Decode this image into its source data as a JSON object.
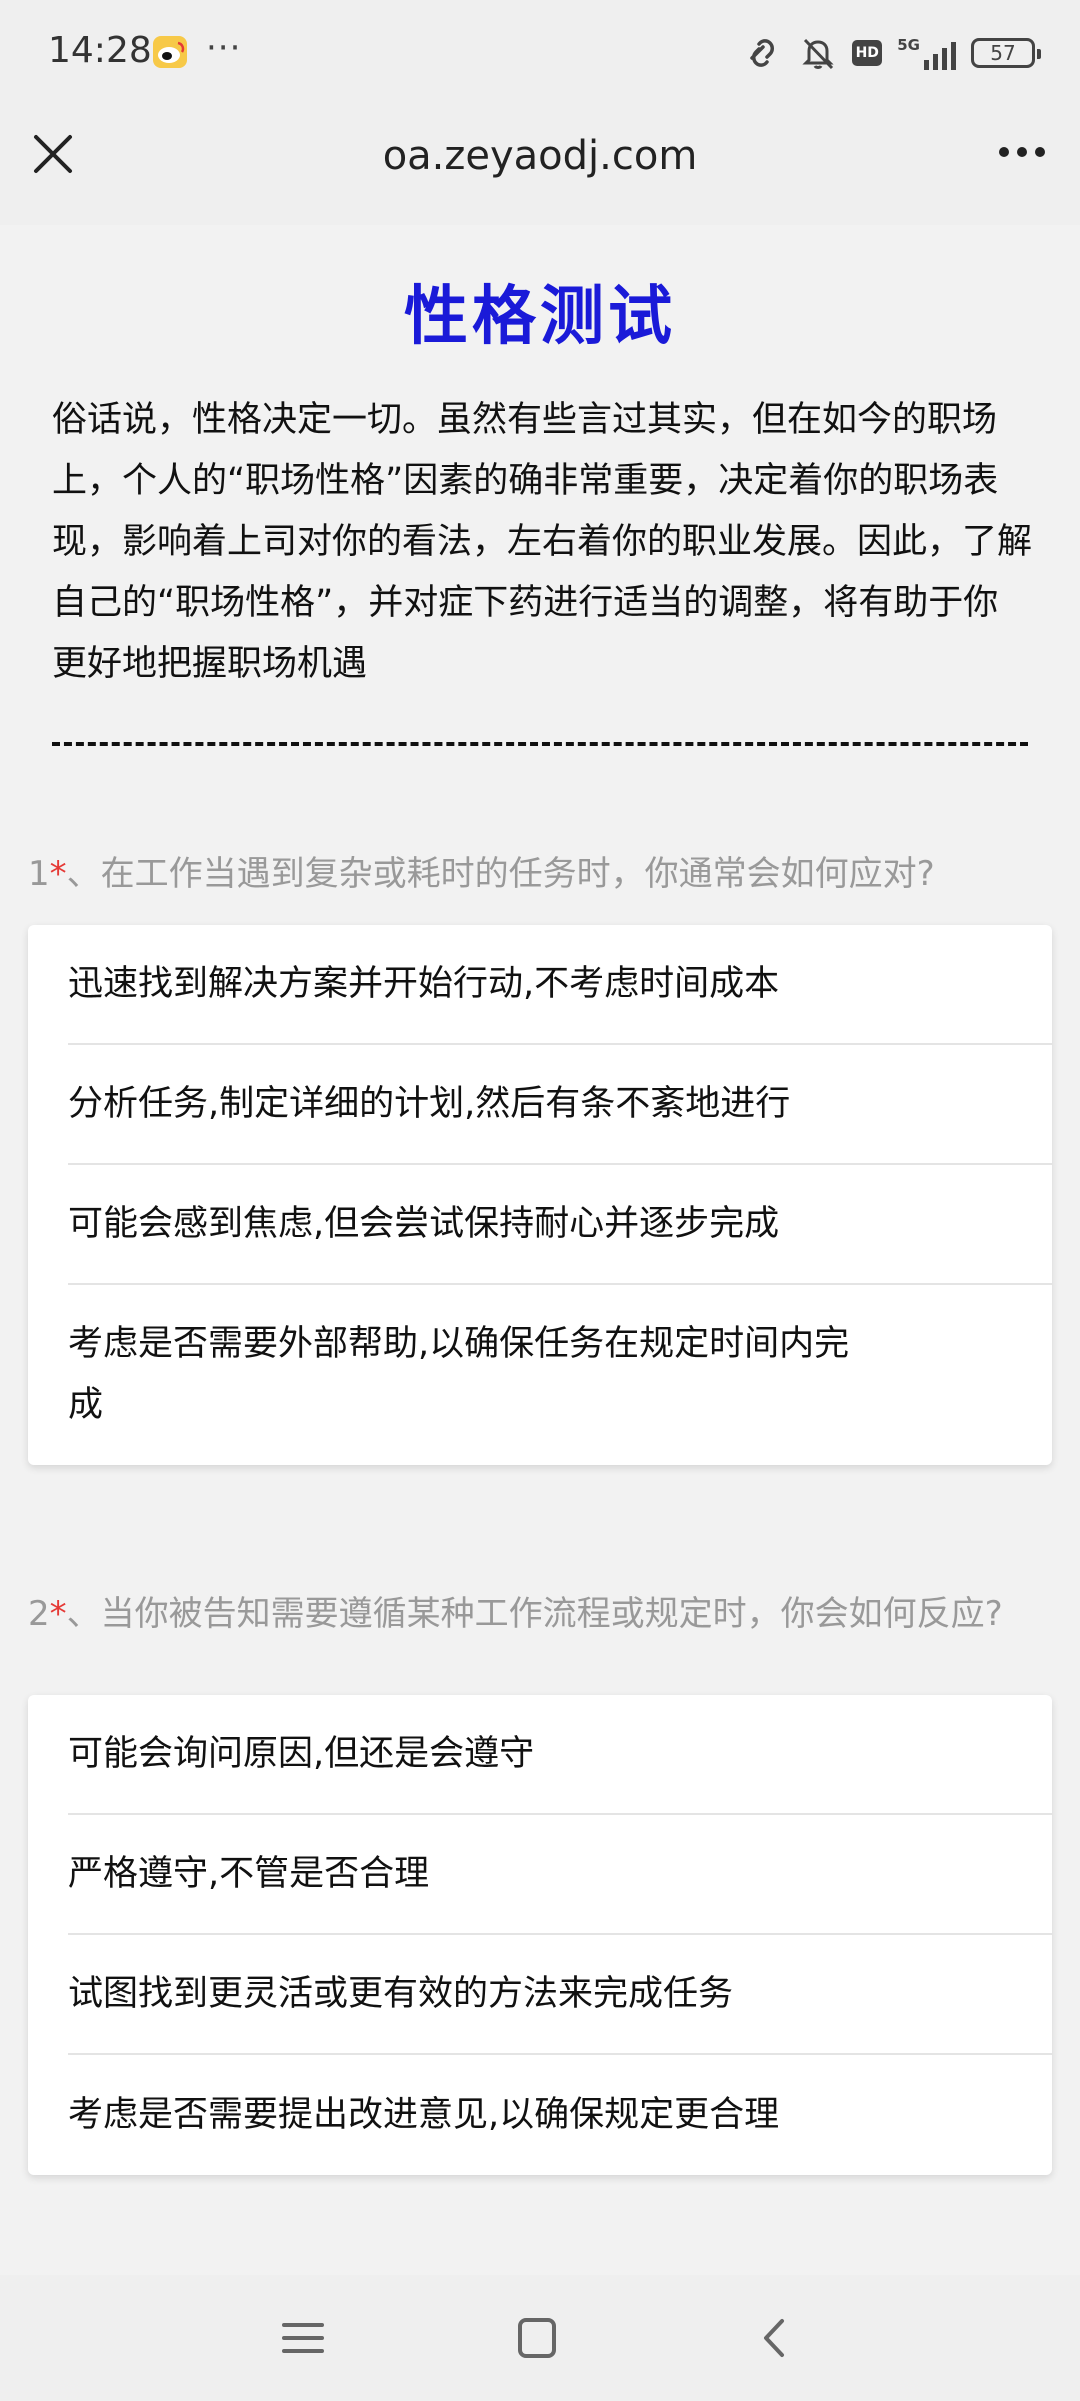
{
  "status_bar": {
    "time": "14:28",
    "dots": "···",
    "battery": "57",
    "network": "5G",
    "hd": "HD",
    "icons": [
      "weibo-icon",
      "link-icon",
      "bell-muted-icon",
      "hd-icon",
      "signal-icon",
      "battery-icon"
    ]
  },
  "browser": {
    "url": "oa.zeyaodj.com",
    "icons": [
      "close-icon",
      "more-menu-icon"
    ]
  },
  "page": {
    "title": "性格测试",
    "intro": "俗话说，性格决定一切。虽然有些言过其实，但在如今的职场上，个人的“职场性格”因素的确非常重要，决定着你的职场表现，影响着上司对你的看法，左右着你的职业发展。因此，了解自己的“职场性格”，并对症下药进行适当的调整，将有助于你更好地把握职场机遇"
  },
  "questions": [
    {
      "number": "1",
      "required_mark": "*",
      "text": "、在工作当遇到复杂或耗时的任务时，你通常会如何应对?",
      "options": [
        "迅速找到解决方案并开始行动,不考虑时间成本",
        "分析任务,制定详细的计划,然后有条不紊地进行",
        "可能会感到焦虑,但会尝试保持耐心并逐步完成",
        "考虑是否需要外部帮助,以确保任务在规定时间内完成"
      ]
    },
    {
      "number": "2",
      "required_mark": "*",
      "text": "、当你被告知需要遵循某种工作流程或规定时，你会如何反应?",
      "options": [
        "可能会询问原因,但还是会遵守",
        "严格遵守,不管是否合理",
        "试图找到更灵活或更有效的方法来完成任务",
        "考虑是否需要提出改进意见,以确保规定更合理"
      ]
    }
  ],
  "bottom_nav": {
    "icons": [
      "menu-icon",
      "home-icon",
      "back-icon"
    ]
  }
}
